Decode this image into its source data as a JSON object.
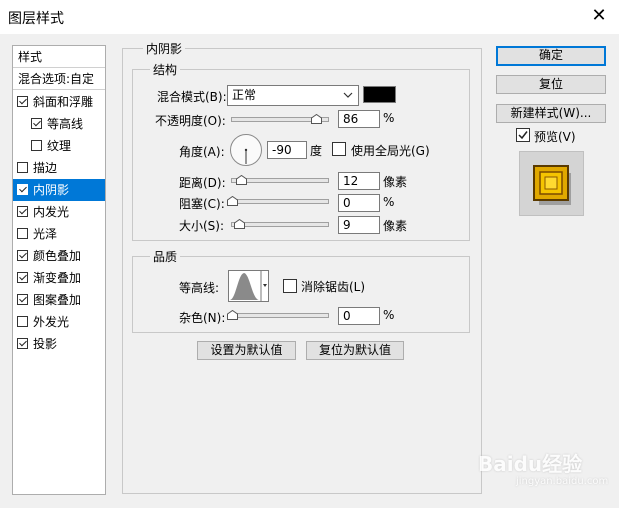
{
  "window": {
    "title": "图层样式",
    "close_glyph": "✕"
  },
  "sidebar": {
    "header": "样式",
    "blend_options": "混合选项:自定",
    "items": [
      {
        "label": "斜面和浮雕",
        "checked": true,
        "sub": false
      },
      {
        "label": "等高线",
        "checked": true,
        "sub": true
      },
      {
        "label": "纹理",
        "checked": false,
        "sub": true
      },
      {
        "label": "描边",
        "checked": false,
        "sub": false
      },
      {
        "label": "内阴影",
        "checked": true,
        "sub": false,
        "selected": true
      },
      {
        "label": "内发光",
        "checked": true,
        "sub": false
      },
      {
        "label": "光泽",
        "checked": false,
        "sub": false
      },
      {
        "label": "颜色叠加",
        "checked": true,
        "sub": false
      },
      {
        "label": "渐变叠加",
        "checked": true,
        "sub": false
      },
      {
        "label": "图案叠加",
        "checked": true,
        "sub": false
      },
      {
        "label": "外发光",
        "checked": false,
        "sub": false
      },
      {
        "label": "投影",
        "checked": true,
        "sub": false
      }
    ]
  },
  "panel": {
    "section_title": "内阴影",
    "structure": {
      "title": "结构",
      "blend_mode_label": "混合模式(B):",
      "blend_mode_value": "正常",
      "shadow_color": "#000000",
      "opacity_label": "不透明度(O):",
      "opacity_value": "86",
      "opacity_unit": "%",
      "opacity_level": 0.86,
      "angle_label": "角度(A):",
      "angle_value": "-90",
      "angle_unit": "度",
      "global_light_label": "使用全局光(G)",
      "global_light_checked": false,
      "distance_label": "距离(D):",
      "distance_value": "12",
      "distance_unit": "像素",
      "choke_label": "阻塞(C):",
      "choke_value": "0",
      "choke_unit": "%",
      "size_label": "大小(S):",
      "size_value": "9",
      "size_unit": "像素"
    },
    "quality": {
      "title": "品质",
      "contour_label": "等高线:",
      "antialias_label": "消除锯齿(L)",
      "antialias_checked": false,
      "noise_label": "杂色(N):",
      "noise_value": "0",
      "noise_unit": "%"
    },
    "make_default": "设置为默认值",
    "reset_default": "复位为默认值"
  },
  "buttons": {
    "ok": "确定",
    "reset": "复位",
    "new_style": "新建样式(W)...",
    "preview_label": "预览(V)",
    "preview_checked": true
  },
  "watermark": {
    "text": "Baidu经验",
    "sub": "jingyan.baidu.com"
  },
  "colors": {
    "accent": "#0078d7",
    "preview_gold": "#e0a800"
  }
}
